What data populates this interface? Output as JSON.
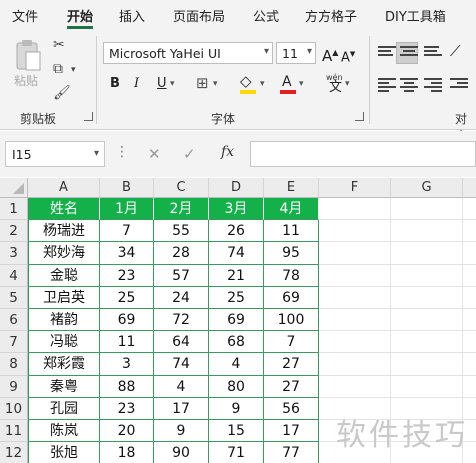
{
  "ribbon_tabs": [
    "文件",
    "开始",
    "插入",
    "页面布局",
    "公式",
    "方方格子",
    "DIY工具箱"
  ],
  "active_tab": "开始",
  "clipboard": {
    "paste_label": "粘贴",
    "group_label": "剪贴板"
  },
  "font": {
    "name": "Microsoft YaHei UI",
    "size": "11",
    "group_label": "字体",
    "bold": "B",
    "italic": "I",
    "underline": "U",
    "grow": "A",
    "shrink": "A",
    "font_color_letter": "A",
    "pinyin": "wén"
  },
  "alignment": {
    "group_label": "对齐"
  },
  "formula_bar": {
    "name_box": "I15",
    "fx": "fx",
    "value": ""
  },
  "sheet": {
    "columns": [
      "A",
      "B",
      "C",
      "D",
      "E",
      "F",
      "G"
    ],
    "rows": [
      "1",
      "2",
      "3",
      "4",
      "5",
      "6",
      "7",
      "8",
      "9",
      "10",
      "11",
      "12"
    ],
    "headers": [
      "姓名",
      "1月",
      "2月",
      "3月",
      "4月"
    ],
    "data": [
      [
        "杨瑞进",
        "7",
        "55",
        "26",
        "11"
      ],
      [
        "郑妙海",
        "34",
        "28",
        "74",
        "95"
      ],
      [
        "金聪",
        "23",
        "57",
        "21",
        "78"
      ],
      [
        "卫启英",
        "25",
        "24",
        "25",
        "69"
      ],
      [
        "褚韵",
        "69",
        "72",
        "69",
        "100"
      ],
      [
        "冯聪",
        "11",
        "64",
        "68",
        "7"
      ],
      [
        "郑彩霞",
        "3",
        "74",
        "4",
        "27"
      ],
      [
        "秦粤",
        "88",
        "4",
        "80",
        "27"
      ],
      [
        "孔园",
        "23",
        "17",
        "9",
        "56"
      ],
      [
        "陈岚",
        "20",
        "9",
        "15",
        "17"
      ],
      [
        "张旭",
        "18",
        "90",
        "71",
        "77"
      ]
    ]
  },
  "watermark": "软件技巧",
  "colors": {
    "header_fill": "#14b14b",
    "table_border": "#3a9a62",
    "accent": "#217346"
  }
}
